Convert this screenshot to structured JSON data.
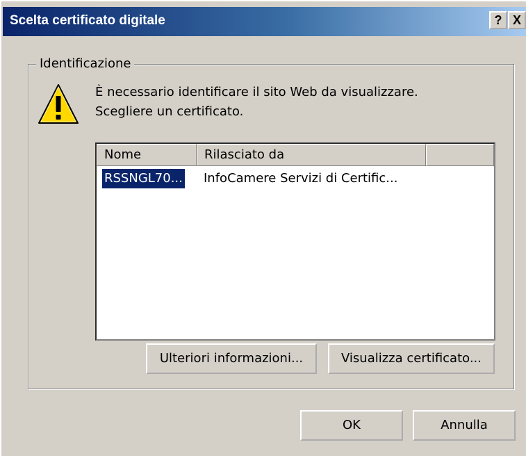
{
  "window": {
    "title": "Scelta certificato digitale",
    "help_label": "?",
    "close_label": "X"
  },
  "group": {
    "label": "Identificazione"
  },
  "message": {
    "line1": "È necessario identificare il sito Web da visualizzare.",
    "line2": "Scegliere un certificato."
  },
  "list": {
    "columns": [
      "Nome",
      "Rilasciato da",
      ""
    ],
    "rows": [
      {
        "name": "RSSNGL70...",
        "issuer": "InfoCamere Servizi di Certific...",
        "selected": true
      }
    ]
  },
  "buttons": {
    "more_info": "Ulteriori informazioni...",
    "view_cert": "Visualizza certificato...",
    "ok": "OK",
    "cancel": "Annulla"
  },
  "colors": {
    "title_gradient_start": "#0a246a",
    "title_gradient_end": "#a6caf0",
    "face": "#d4d0c8",
    "selection": "#0a246a",
    "warning": "#ffd800"
  },
  "icons": {
    "warning": "warning-triangle-icon"
  }
}
